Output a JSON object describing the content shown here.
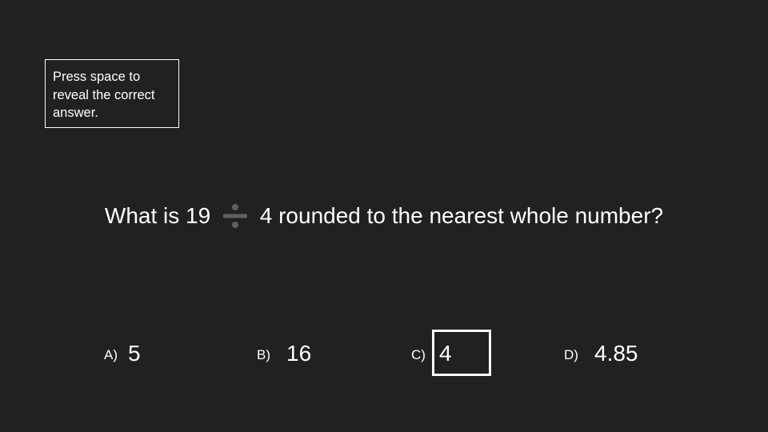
{
  "hint": {
    "text": "Press space to reveal the correct answer."
  },
  "question": {
    "before": "What is 19",
    "operator_icon": "division-sign-icon",
    "after": "4 rounded to the nearest whole number?"
  },
  "options": [
    {
      "letter": "A)",
      "value": "5"
    },
    {
      "letter": "B)",
      "value": "16"
    },
    {
      "letter": "C)",
      "value": "4",
      "highlighted": true
    },
    {
      "letter": "D)",
      "value": "4.85"
    }
  ],
  "colors": {
    "background": "#212121",
    "text": "#ffffff",
    "operator": "#5f5f5f"
  }
}
